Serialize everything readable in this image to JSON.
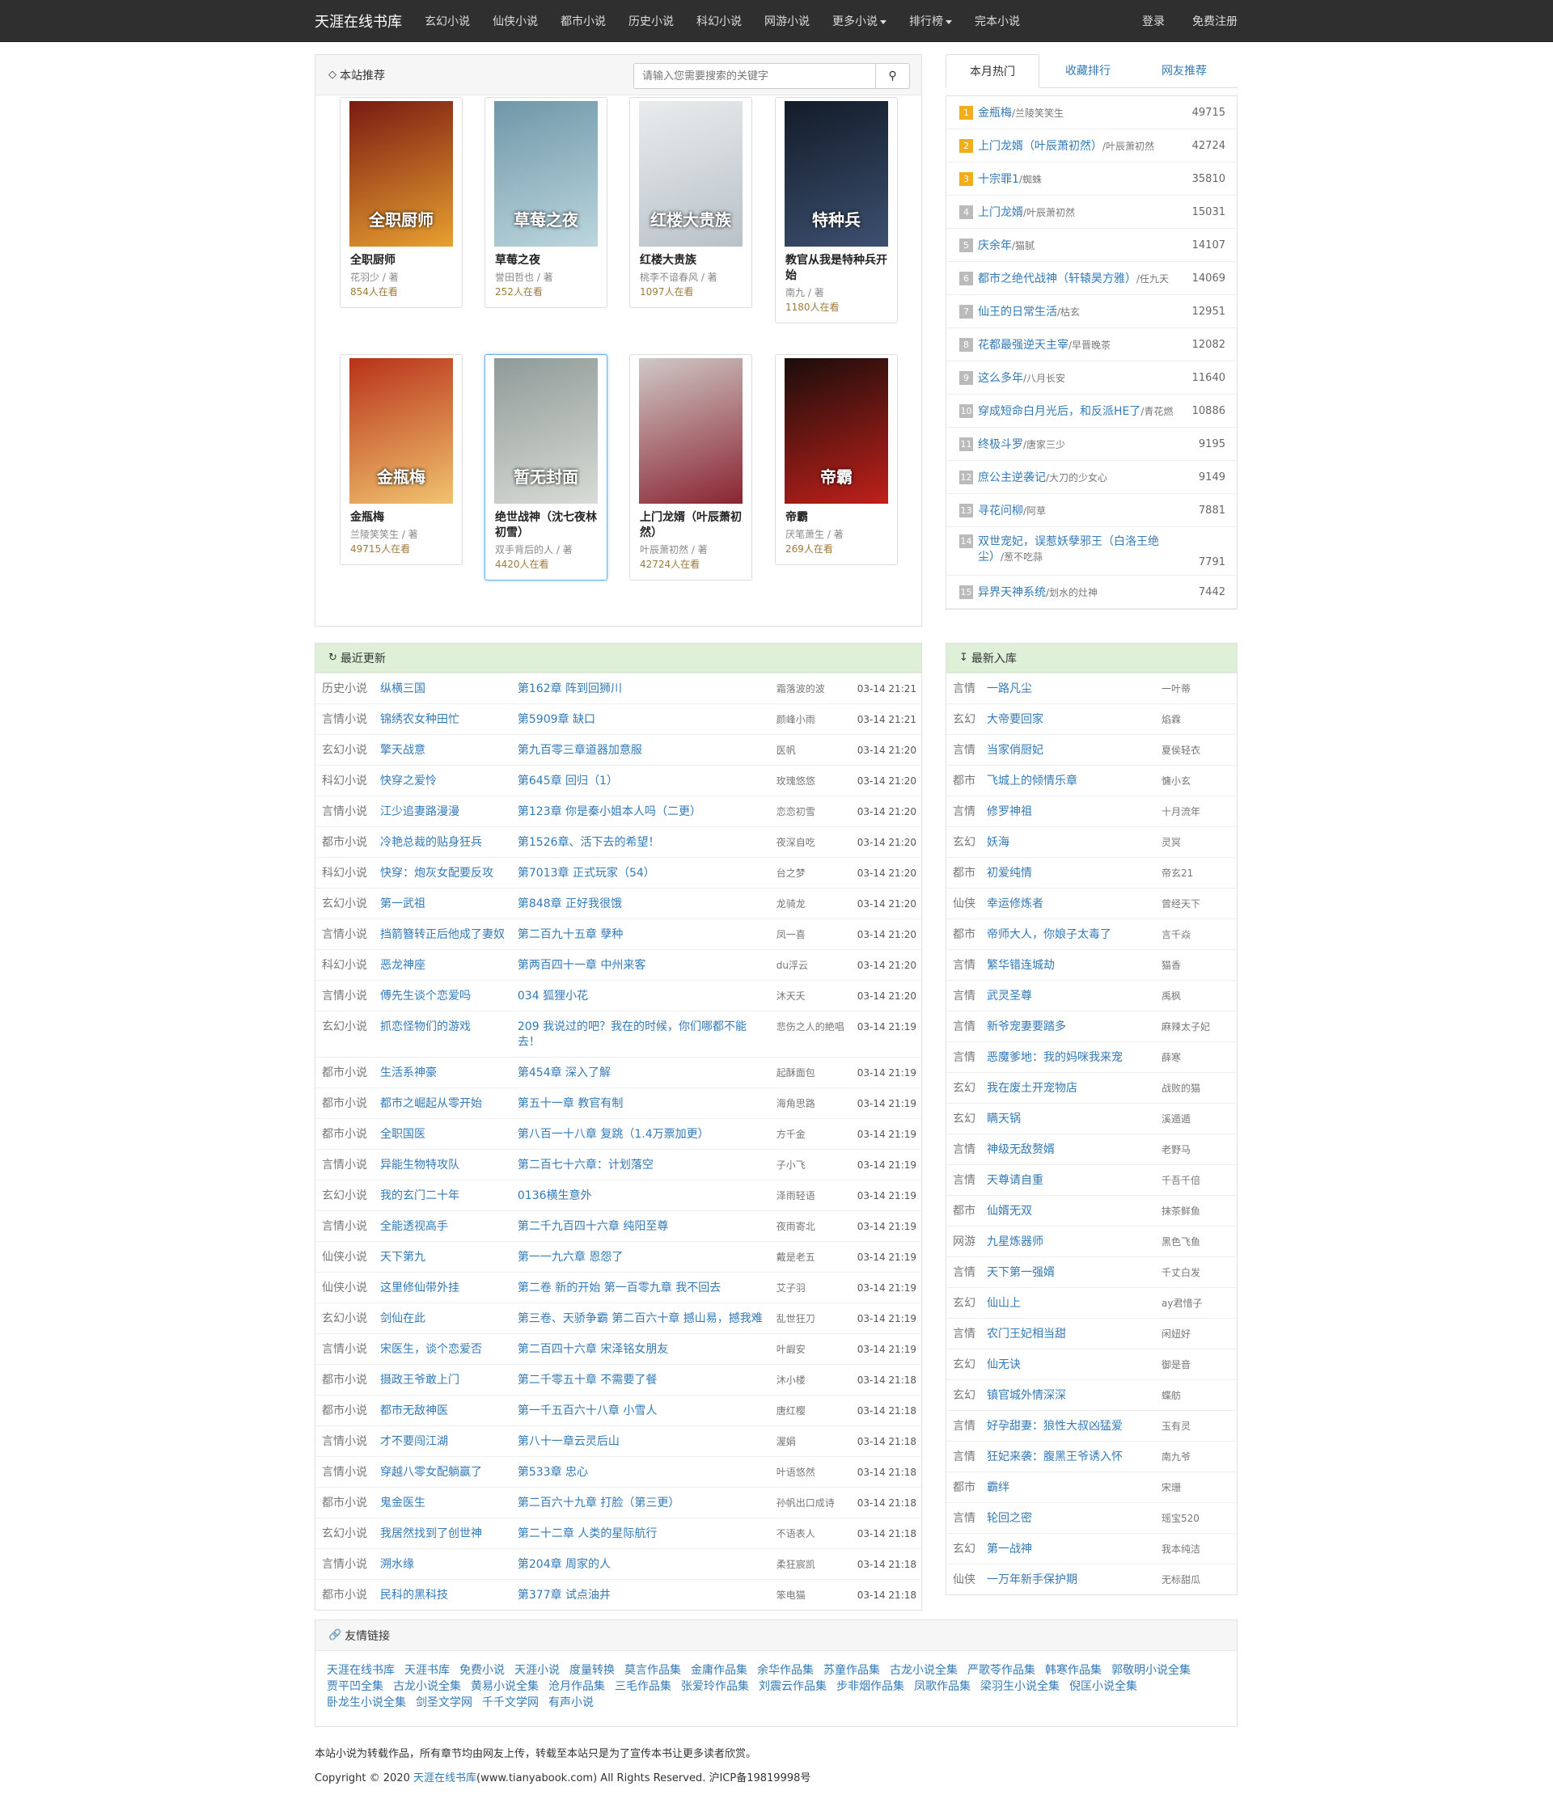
{
  "nav": {
    "brand": "天涯在线书库",
    "items": [
      "玄幻小说",
      "仙侠小说",
      "都市小说",
      "历史小说",
      "科幻小说",
      "网游小说"
    ],
    "more": "更多小说",
    "rank": "排行榜",
    "finished": "完本小说",
    "login": "登录",
    "register": "免费注册"
  },
  "recommend": {
    "title": "本站推荐",
    "search_placeholder": "请输入您需要搜索的关键字",
    "books": [
      {
        "title": "全职厨师",
        "author": "花羽少 / 著",
        "readers": "854人在看",
        "c1": "#7a1a12",
        "c2": "#e8a030",
        "cover_text": "全职厨师"
      },
      {
        "title": "草莓之夜",
        "author": "誉田哲也 / 著",
        "readers": "252人在看",
        "c1": "#6f97a8",
        "c2": "#bcd6de",
        "cover_text": "草莓之夜"
      },
      {
        "title": "红楼大贵族",
        "author": "桃李不谙春风 / 著",
        "readers": "1097人在看",
        "c1": "#e8ecee",
        "c2": "#b9c2c8",
        "cover_text": "红楼大贵族"
      },
      {
        "title": "教官从我是特种兵开始",
        "author": "南九 / 著",
        "readers": "1180人在看",
        "c1": "#121b28",
        "c2": "#3d5070",
        "cover_text": "特种兵"
      },
      {
        "title": "金瓶梅",
        "author": "兰陵笑笑生 / 著",
        "readers": "49715人在看",
        "c1": "#b8321a",
        "c2": "#f1c36e",
        "cover_text": "金瓶梅"
      },
      {
        "title": "绝世战神（沈七夜林初雪）",
        "author": "双手背后的人 / 著",
        "readers": "4420人在看",
        "c1": "#8f9a98",
        "c2": "#d8dcd6",
        "cover_text": "暂无封面"
      },
      {
        "title": "上门龙婿（叶辰萧初然）",
        "author": "叶辰萧初然 / 著",
        "readers": "42724人在看",
        "c1": "#cfc9c6",
        "c2": "#8a2432",
        "cover_text": ""
      },
      {
        "title": "帝霸",
        "author": "厌笔萧生 / 著",
        "readers": "269人在看",
        "c1": "#1a0d0b",
        "c2": "#c0201a",
        "cover_text": "帝霸"
      }
    ]
  },
  "tabs": [
    "本月热门",
    "收藏排行",
    "网友推荐"
  ],
  "rank": [
    {
      "n": "1",
      "name": "金瓶梅",
      "author": "/兰陵笑笑生",
      "count": "49715"
    },
    {
      "n": "2",
      "name": "上门龙婿（叶辰萧初然）",
      "author": "/叶辰萧初然",
      "count": "42724"
    },
    {
      "n": "3",
      "name": "十宗罪1",
      "author": "/蜘蛛",
      "count": "35810"
    },
    {
      "n": "4",
      "name": "上门龙婿",
      "author": "/叶辰萧初然",
      "count": "15031"
    },
    {
      "n": "5",
      "name": "庆余年",
      "author": "/猫腻",
      "count": "14107"
    },
    {
      "n": "6",
      "name": "都市之绝代战神（轩辕昊方雅）",
      "author": "/任九天",
      "count": "14069"
    },
    {
      "n": "7",
      "name": "仙王的日常生活",
      "author": "/枯玄",
      "count": "12951"
    },
    {
      "n": "8",
      "name": "花都最强逆天主宰",
      "author": "/早晋晚茶",
      "count": "12082"
    },
    {
      "n": "9",
      "name": "这么多年",
      "author": "/八月长安",
      "count": "11640"
    },
    {
      "n": "10",
      "name": "穿成短命白月光后，和反派HE了",
      "author": "/青花燃",
      "count": "10886"
    },
    {
      "n": "11",
      "name": "终极斗罗",
      "author": "/唐家三少",
      "count": "9195"
    },
    {
      "n": "12",
      "name": "庶公主逆袭记",
      "author": "/大刀的少女心",
      "count": "9149"
    },
    {
      "n": "13",
      "name": "寻花问柳",
      "author": "/阿草",
      "count": "7881"
    },
    {
      "n": "14",
      "name": "双世宠妃，误惹妖孽邪王（白洛王绝尘）",
      "author": "/葱不吃蒜",
      "count": "7791"
    },
    {
      "n": "15",
      "name": "异界天神系统",
      "author": "/划水的灶神",
      "count": "7442"
    }
  ],
  "updates_title": "最近更新",
  "updates": [
    {
      "cat": "历史小说",
      "book": "纵横三国",
      "chap": "第162章 阵到回狮川",
      "author": "霜落波的波",
      "time": "03-14 21:21"
    },
    {
      "cat": "言情小说",
      "book": "锦绣农女种田忙",
      "chap": "第5909章 缺口",
      "author": "颜峰小雨",
      "time": "03-14 21:21"
    },
    {
      "cat": "玄幻小说",
      "book": "擎天战意",
      "chap": "第九百零三章道器加意服",
      "author": "医帆",
      "time": "03-14 21:20"
    },
    {
      "cat": "科幻小说",
      "book": "快穿之爱怜",
      "chap": "第645章 回归（1）",
      "author": "玫瑰悠悠",
      "time": "03-14 21:20"
    },
    {
      "cat": "言情小说",
      "book": "江少追妻路漫漫",
      "chap": "第123章 你是秦小姐本人吗（二更）",
      "author": "恋恋初雪",
      "time": "03-14 21:20"
    },
    {
      "cat": "都市小说",
      "book": "冷艳总裁的贴身狂兵",
      "chap": "第1526章、活下去的希望！",
      "author": "夜深自吃",
      "time": "03-14 21:20"
    },
    {
      "cat": "科幻小说",
      "book": "快穿：炮灰女配要反攻",
      "chap": "第7013章 正式玩家（54）",
      "author": "台之梦",
      "time": "03-14 21:20"
    },
    {
      "cat": "玄幻小说",
      "book": "第一武祖",
      "chap": "第848章 正好我很饿",
      "author": "龙骑龙",
      "time": "03-14 21:20"
    },
    {
      "cat": "言情小说",
      "book": "挡箭簪转正后他成了妻奴",
      "chap": "第二百九十五章 孽种",
      "author": "凤一喜",
      "time": "03-14 21:20"
    },
    {
      "cat": "科幻小说",
      "book": "恶龙神座",
      "chap": "第两百四十一章 中州来客",
      "author": "du浮云",
      "time": "03-14 21:20"
    },
    {
      "cat": "言情小说",
      "book": "傅先生谈个恋爱吗",
      "chap": "034 狐狸小花",
      "author": "沐天夭",
      "time": "03-14 21:20"
    },
    {
      "cat": "玄幻小说",
      "book": "抓恋怪物们的游戏",
      "chap": "209 我说过的吧？我在的时候，你们哪都不能去！",
      "author": "悲伤之人的絶唱",
      "time": "03-14 21:19"
    },
    {
      "cat": "都市小说",
      "book": "生活系神豪",
      "chap": "第454章 深入了解",
      "author": "起酥面包",
      "time": "03-14 21:19"
    },
    {
      "cat": "都市小说",
      "book": "都市之崛起从零开始",
      "chap": "第五十一章 教官有制",
      "author": "海角思路",
      "time": "03-14 21:19"
    },
    {
      "cat": "都市小说",
      "book": "全职国医",
      "chap": "第八百一十八章 复跳（1.4万票加更）",
      "author": "方千金",
      "time": "03-14 21:19"
    },
    {
      "cat": "言情小说",
      "book": "异能生物特攻队",
      "chap": "第二百七十六章：计划落空",
      "author": "子小飞",
      "time": "03-14 21:19"
    },
    {
      "cat": "玄幻小说",
      "book": "我的玄门二十年",
      "chap": "0136横生意外",
      "author": "泽雨轻语",
      "time": "03-14 21:19"
    },
    {
      "cat": "言情小说",
      "book": "全能透视高手",
      "chap": "第二千九百四十六章 纯阳至尊",
      "author": "夜雨寄北",
      "time": "03-14 21:19"
    },
    {
      "cat": "仙侠小说",
      "book": "天下第九",
      "chap": "第一一九六章 恩怨了",
      "author": "戴是老五",
      "time": "03-14 21:19"
    },
    {
      "cat": "仙侠小说",
      "book": "这里修仙带外挂",
      "chap": "第二卷 新的开始 第一百零九章 我不回去",
      "author": "艾子羽",
      "time": "03-14 21:19"
    },
    {
      "cat": "玄幻小说",
      "book": "剑仙在此",
      "chap": "第三卷、天骄争霸 第二百六十章 撼山易，撼我难",
      "author": "乱世狂刀",
      "time": "03-14 21:19"
    },
    {
      "cat": "言情小说",
      "book": "宋医生，谈个恋爱否",
      "chap": "第二百四十六章 宋泽铭女朋友",
      "author": "叶嘏安",
      "time": "03-14 21:19"
    },
    {
      "cat": "都市小说",
      "book": "摄政王爷敢上门",
      "chap": "第二千零五十章 不需要了餐",
      "author": "沐小楼",
      "time": "03-14 21:18"
    },
    {
      "cat": "都市小说",
      "book": "都市无敌神医",
      "chap": "第一千五百六十八章 小雪人",
      "author": "唐红樱",
      "time": "03-14 21:18"
    },
    {
      "cat": "言情小说",
      "book": "才不要闯江湖",
      "chap": "第八十一章云灵后山",
      "author": "渥娟",
      "time": "03-14 21:18"
    },
    {
      "cat": "言情小说",
      "book": "穿越八零女配躺赢了",
      "chap": "第533章 忠心",
      "author": "叶语悠然",
      "time": "03-14 21:18"
    },
    {
      "cat": "都市小说",
      "book": "鬼金医生",
      "chap": "第二百六十九章 打脸（第三更）",
      "author": "孙帆出口成诗",
      "time": "03-14 21:18"
    },
    {
      "cat": "玄幻小说",
      "book": "我居然找到了创世神",
      "chap": "第二十二章 人类的星际航行",
      "author": "不语表人",
      "time": "03-14 21:18"
    },
    {
      "cat": "言情小说",
      "book": "溯水缘",
      "chap": "第204章 周家的人",
      "author": "柔狂宸凯",
      "time": "03-14 21:18"
    },
    {
      "cat": "都市小说",
      "book": "民科的黑科技",
      "chap": "第377章 试点油井",
      "author": "笨电猫",
      "time": "03-14 21:18"
    }
  ],
  "newbooks_title": "最新入库",
  "newbooks": [
    {
      "cat": "言情",
      "book": "一路凡尘",
      "author": "一叶蒂"
    },
    {
      "cat": "玄幻",
      "book": "大帝要回家",
      "author": "焰霖"
    },
    {
      "cat": "言情",
      "book": "当家俏厨妃",
      "author": "夏侯轻衣"
    },
    {
      "cat": "都市",
      "book": "飞城上的倾情乐章",
      "author": "慵小玄"
    },
    {
      "cat": "言情",
      "book": "修罗神祖",
      "author": "十月流年"
    },
    {
      "cat": "玄幻",
      "book": "妖海",
      "author": "灵冥"
    },
    {
      "cat": "都市",
      "book": "初爱纯情",
      "author": "帝玄21"
    },
    {
      "cat": "仙侠",
      "book": "幸运修炼者",
      "author": "曾经天下"
    },
    {
      "cat": "都市",
      "book": "帝师大人，你娘子太毒了",
      "author": "言千焱"
    },
    {
      "cat": "言情",
      "book": "繁华错连城劫",
      "author": "猫香"
    },
    {
      "cat": "言情",
      "book": "武灵圣尊",
      "author": "禹枫"
    },
    {
      "cat": "言情",
      "book": "新爷宠妻要踏多",
      "author": "麻辣太子妃"
    },
    {
      "cat": "言情",
      "book": "恶魔爹地：我的妈咪我来宠",
      "author": "薛寒"
    },
    {
      "cat": "玄幻",
      "book": "我在废土开宠物店",
      "author": "战败的猫"
    },
    {
      "cat": "玄幻",
      "book": "瞒天锅",
      "author": "溪遁遁"
    },
    {
      "cat": "言情",
      "book": "神级无敌赘婿",
      "author": "老野马"
    },
    {
      "cat": "言情",
      "book": "天尊请自重",
      "author": "千吾千倍"
    },
    {
      "cat": "都市",
      "book": "仙婿无双",
      "author": "抹茶鲜鱼"
    },
    {
      "cat": "网游",
      "book": "九星炼器师",
      "author": "黑色飞鱼"
    },
    {
      "cat": "言情",
      "book": "天下第一强婿",
      "author": "千丈白发"
    },
    {
      "cat": "玄幻",
      "book": "仙山上",
      "author": "ay君惜子"
    },
    {
      "cat": "言情",
      "book": "农门王妃相当甜",
      "author": "闲妞好"
    },
    {
      "cat": "玄幻",
      "book": "仙无诀",
      "author": "御是音"
    },
    {
      "cat": "玄幻",
      "book": "镇官城外情深深",
      "author": "蝶舫"
    },
    {
      "cat": "言情",
      "book": "好孕甜妻：狼性大叔凶猛爱",
      "author": "玉有灵"
    },
    {
      "cat": "言情",
      "book": "狂妃来袭：腹黑王爷诱入怀",
      "author": "南九爷"
    },
    {
      "cat": "都市",
      "book": "霸绊",
      "author": "宋珊"
    },
    {
      "cat": "言情",
      "book": "轮回之密",
      "author": "瑶宝520"
    },
    {
      "cat": "玄幻",
      "book": "第一战神",
      "author": "我本纯洁"
    },
    {
      "cat": "仙侠",
      "book": "一万年新手保护期",
      "author": "无标甜瓜"
    }
  ],
  "links_title": "友情链接",
  "links": [
    "天涯在线书库",
    "天涯书库",
    "免费小说",
    "天涯小说",
    "度量转换",
    "莫言作品集",
    "金庸作品集",
    "余华作品集",
    "苏童作品集",
    "古龙小说全集",
    "严歌苓作品集",
    "韩寒作品集",
    "郭敬明小说全集",
    "贾平凹全集",
    "古龙小说全集",
    "黄易小说全集",
    "沧月作品集",
    "三毛作品集",
    "张爱玲作品集",
    "刘震云作品集",
    "步非烟作品集",
    "凤歌作品集",
    "梁羽生小说全集",
    "倪匡小说全集",
    "卧龙生小说全集",
    "剑圣文学网",
    "千千文学网",
    "有声小说"
  ],
  "footer": {
    "line1": "本站小说为转载作品，所有章节均由网友上传，转载至本站只是为了宣传本书让更多读者欣赏。",
    "copy_prefix": "Copyright © 2020",
    "site": "天涯在线书库",
    "copy_suffix": "(www.tianyabook.com) All Rights Reserved. 沪ICP备19819998号"
  }
}
